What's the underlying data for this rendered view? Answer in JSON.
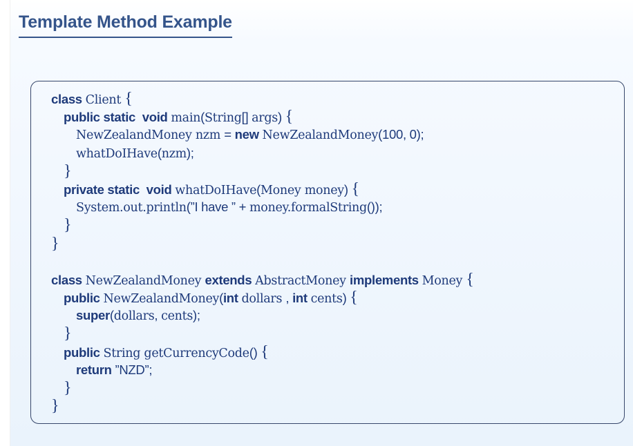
{
  "slide": {
    "title": "Template Method Example"
  },
  "code": {
    "l1": [
      {
        "k": "kw",
        "t": "class "
      },
      {
        "k": "tt",
        "t": "Client "
      },
      {
        "k": "br",
        "t": "{"
      }
    ],
    "l2": [
      {
        "k": "kw",
        "t": "public static  void "
      },
      {
        "k": "tt",
        "t": "main"
      },
      {
        "k": "sf",
        "t": "("
      },
      {
        "k": "tt",
        "t": "String"
      },
      {
        "k": "sf",
        "t": "[] "
      },
      {
        "k": "tt",
        "t": "args"
      },
      {
        "k": "sf",
        "t": ") "
      },
      {
        "k": "br",
        "t": "{"
      }
    ],
    "l3": [
      {
        "k": "tt",
        "t": "NewZealandMoney nzm "
      },
      {
        "k": "sf",
        "t": "= "
      },
      {
        "k": "kw",
        "t": "new "
      },
      {
        "k": "tt",
        "t": "NewZealandMoney"
      },
      {
        "k": "sf",
        "t": "(100, 0);"
      }
    ],
    "l4": [
      {
        "k": "tt",
        "t": "whatDoIHave"
      },
      {
        "k": "sf",
        "t": "("
      },
      {
        "k": "tt",
        "t": "nzm"
      },
      {
        "k": "sf",
        "t": ");"
      }
    ],
    "l5": [
      {
        "k": "br",
        "t": "}"
      }
    ],
    "l6": [
      {
        "k": "kw",
        "t": "private static  void "
      },
      {
        "k": "tt",
        "t": "whatDoIHave"
      },
      {
        "k": "sf",
        "t": "("
      },
      {
        "k": "tt",
        "t": "Money money"
      },
      {
        "k": "sf",
        "t": ") "
      },
      {
        "k": "br",
        "t": "{"
      }
    ],
    "l7": [
      {
        "k": "tt",
        "t": "System.out.println"
      },
      {
        "k": "sf",
        "t": "(”I have ” + "
      },
      {
        "k": "tt",
        "t": "money.formalString"
      },
      {
        "k": "sf",
        "t": "());"
      }
    ],
    "l8": [
      {
        "k": "br",
        "t": "}"
      }
    ],
    "l9": [
      {
        "k": "br",
        "t": "}"
      }
    ],
    "l10": [
      {
        "k": "kw",
        "t": "class "
      },
      {
        "k": "tt",
        "t": "NewZealandMoney "
      },
      {
        "k": "kw",
        "t": "extends "
      },
      {
        "k": "tt",
        "t": "AbstractMoney "
      },
      {
        "k": "kw",
        "t": "implements "
      },
      {
        "k": "tt",
        "t": "Money "
      },
      {
        "k": "br",
        "t": "{"
      }
    ],
    "l11": [
      {
        "k": "kw",
        "t": "public "
      },
      {
        "k": "tt",
        "t": "NewZealandMoney"
      },
      {
        "k": "sf",
        "t": "("
      },
      {
        "k": "kw",
        "t": "int "
      },
      {
        "k": "tt",
        "t": "dollars "
      },
      {
        "k": "sf",
        "t": ", "
      },
      {
        "k": "kw",
        "t": "int "
      },
      {
        "k": "tt",
        "t": "cents"
      },
      {
        "k": "sf",
        "t": ") "
      },
      {
        "k": "br",
        "t": "{"
      }
    ],
    "l12": [
      {
        "k": "kw",
        "t": "super"
      },
      {
        "k": "sf",
        "t": "("
      },
      {
        "k": "tt",
        "t": "dollars"
      },
      {
        "k": "sf",
        "t": ", "
      },
      {
        "k": "tt",
        "t": "cents"
      },
      {
        "k": "sf",
        "t": ");"
      }
    ],
    "l13": [
      {
        "k": "br",
        "t": "}"
      }
    ],
    "l14": [
      {
        "k": "kw",
        "t": "public "
      },
      {
        "k": "tt",
        "t": "String getCurrencyCode"
      },
      {
        "k": "sf",
        "t": "() "
      },
      {
        "k": "br",
        "t": "{"
      }
    ],
    "l15": [
      {
        "k": "kw",
        "t": "return "
      },
      {
        "k": "sf",
        "t": "”NZD”;"
      }
    ],
    "l16": [
      {
        "k": "br",
        "t": "}"
      }
    ],
    "l17": [
      {
        "k": "br",
        "t": "}"
      }
    ]
  }
}
